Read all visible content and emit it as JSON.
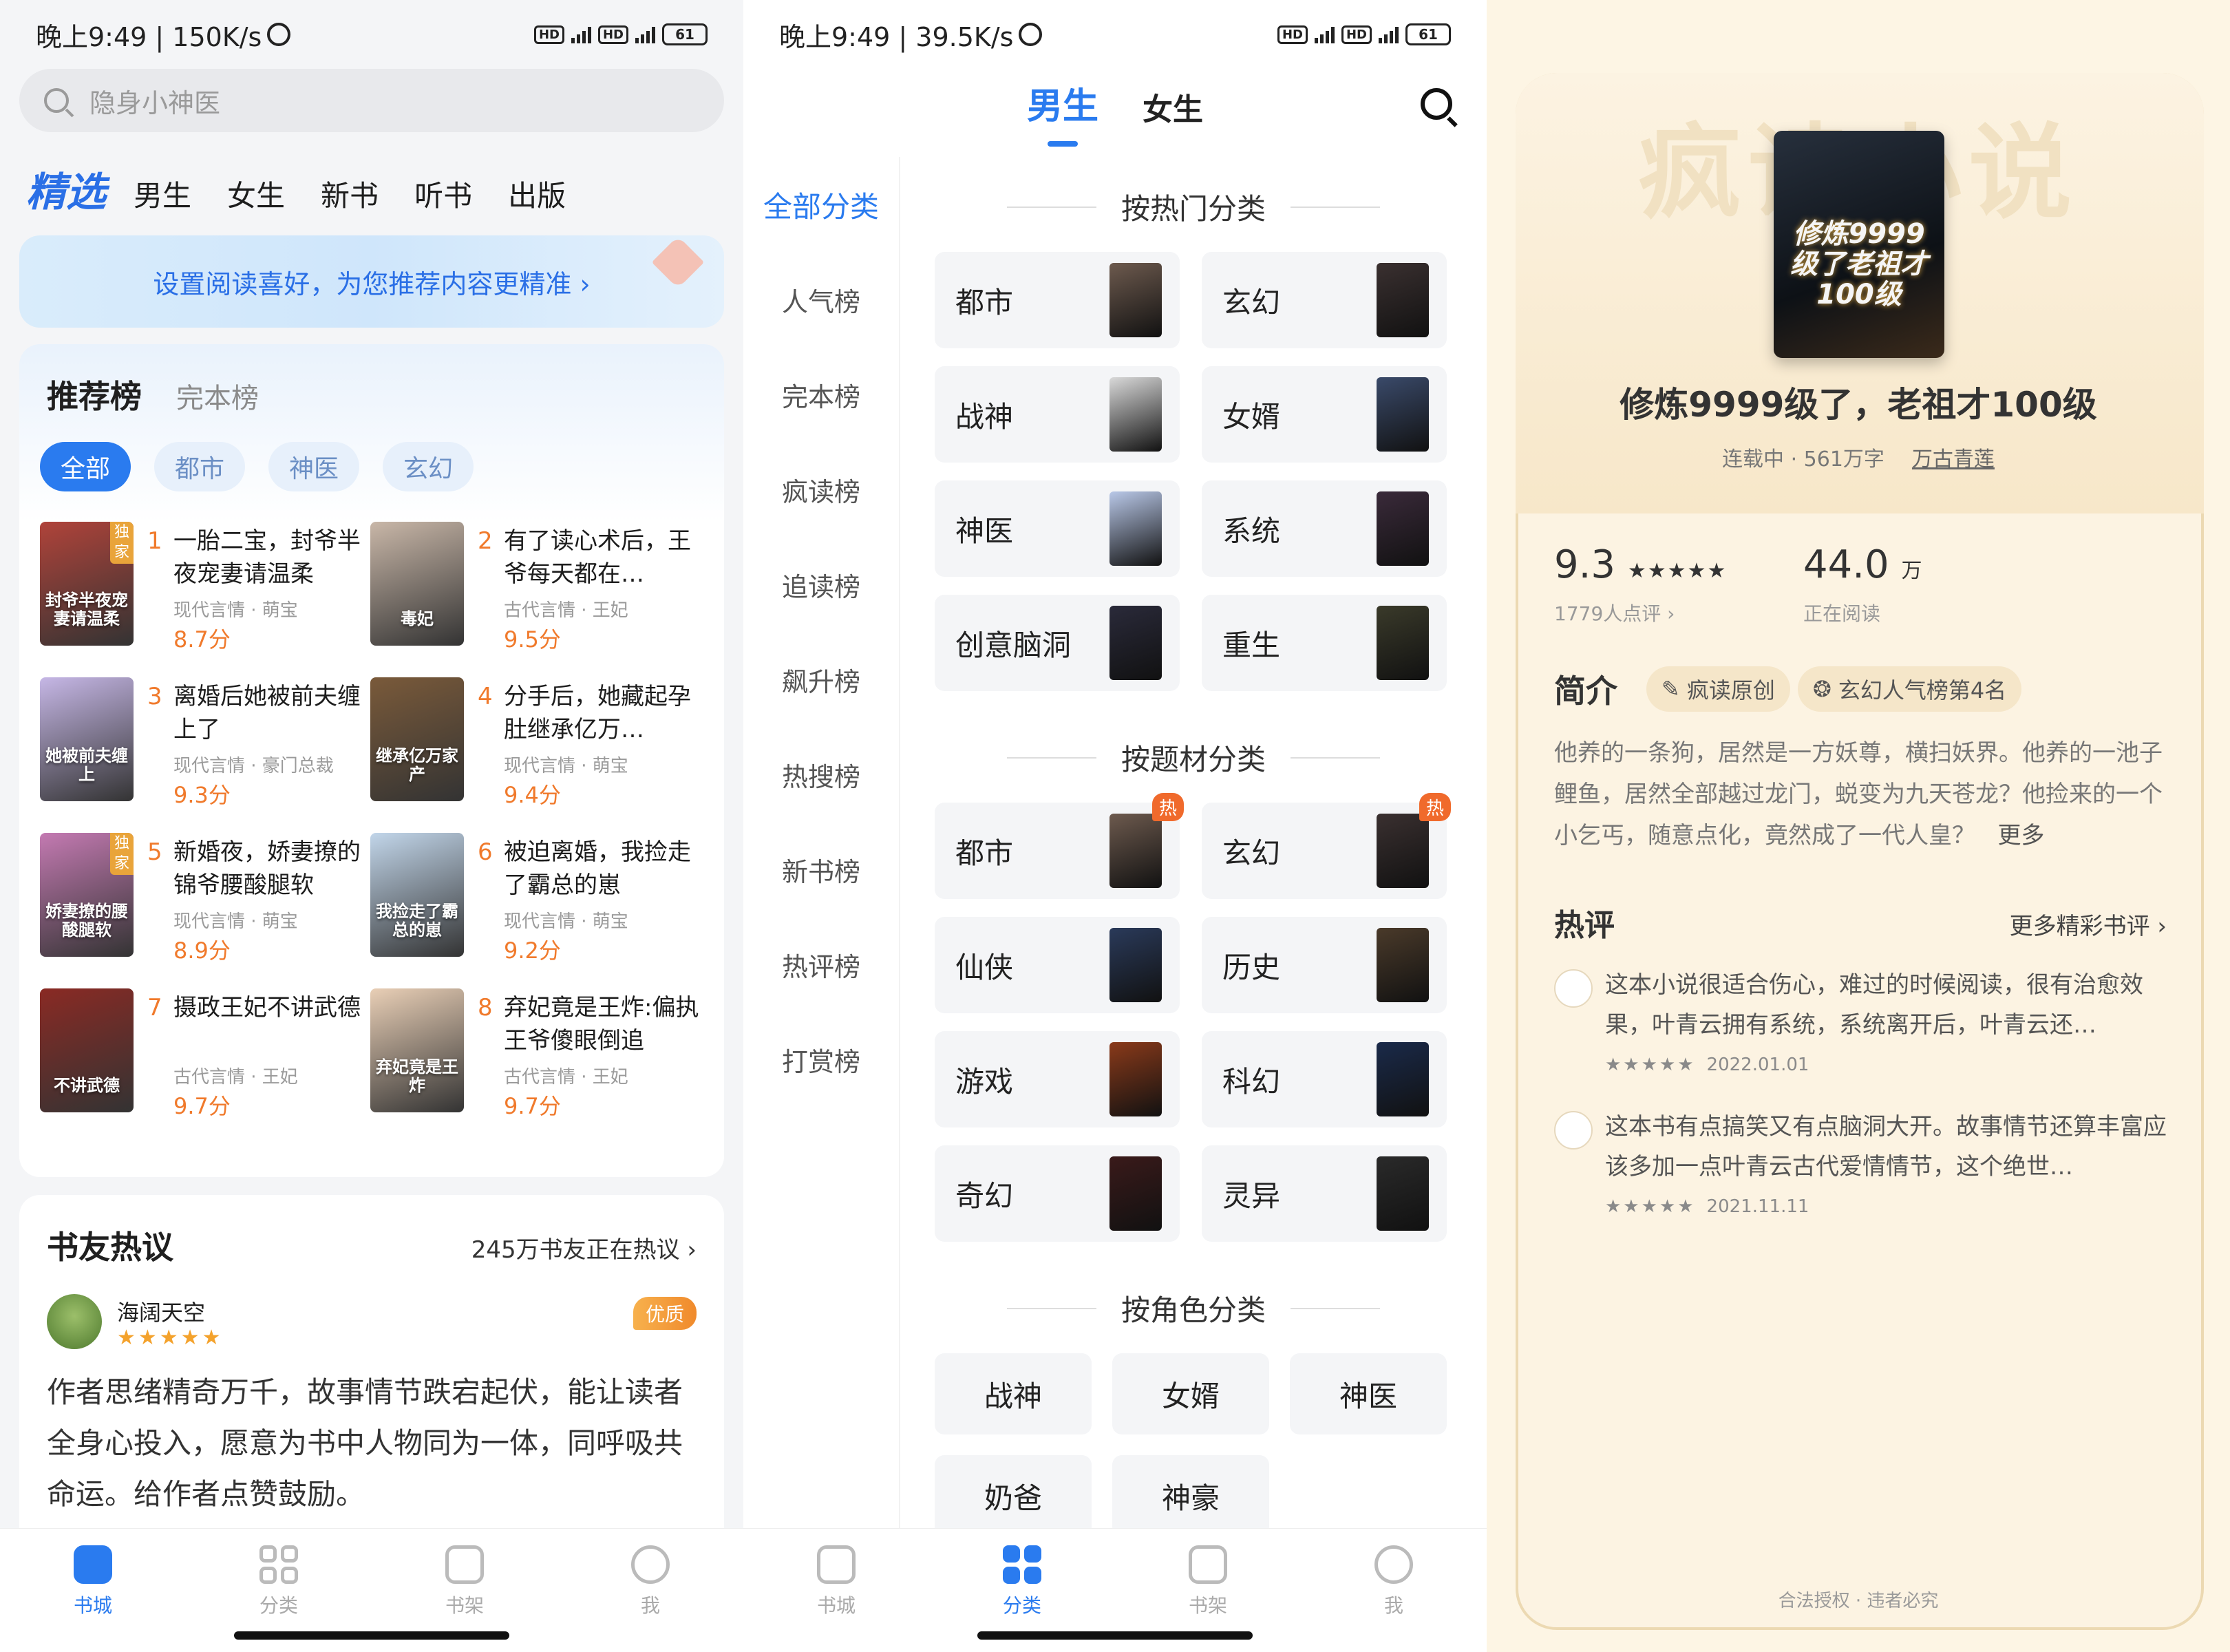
{
  "panel1": {
    "status": {
      "time": "晚上9:49 | 150K/s",
      "battery": "61"
    },
    "search": {
      "placeholder": "隐身小神医"
    },
    "nav": [
      "精选",
      "男生",
      "女生",
      "新书",
      "听书",
      "出版"
    ],
    "banner": "设置阅读喜好，为您推荐内容更精准 ›",
    "rank": {
      "title": "推荐榜",
      "subtitle": "完本榜",
      "chips": [
        "全部",
        "都市",
        "神医",
        "玄幻"
      ],
      "books": [
        {
          "num": "1",
          "title": "一胎二宝，封爷半夜宠妻请温柔",
          "meta": "现代言情 · 萌宝",
          "score": "8.7分",
          "cover_text": "封爷半夜宠妻请温柔",
          "tag": "独家",
          "cover_color": "#b0433a"
        },
        {
          "num": "2",
          "title": "有了读心术后，王爷每天都在…",
          "meta": "古代言情 · 王妃",
          "score": "9.5分",
          "cover_text": "毒妃",
          "tag": "",
          "cover_color": "#c9b7a8"
        },
        {
          "num": "3",
          "title": "离婚后她被前夫缠上了",
          "meta": "现代言情 · 豪门总裁",
          "score": "9.3分",
          "cover_text": "她被前夫缠上",
          "tag": "",
          "cover_color": "#c6b7e6"
        },
        {
          "num": "4",
          "title": "分手后，她藏起孕肚继承亿万…",
          "meta": "现代言情 · 萌宝",
          "score": "9.4分",
          "cover_text": "继承亿万家产",
          "tag": "",
          "cover_color": "#7a5a3a"
        },
        {
          "num": "5",
          "title": "新婚夜，娇妻撩的锦爷腰酸腿软",
          "meta": "现代言情 · 萌宝",
          "score": "8.9分",
          "cover_text": "娇妻撩的腰酸腿软",
          "tag": "独家",
          "cover_color": "#c47ab2"
        },
        {
          "num": "6",
          "title": "被迫离婚，我捡走了霸总的崽",
          "meta": "现代言情 · 萌宝",
          "score": "9.2分",
          "cover_text": "我捡走了霸总的崽",
          "tag": "",
          "cover_color": "#c2d6ea"
        },
        {
          "num": "7",
          "title": "摄政王妃不讲武德",
          "meta": "古代言情 · 王妃",
          "score": "9.7分",
          "cover_text": "不讲武德",
          "tag": "",
          "cover_color": "#8a2a24"
        },
        {
          "num": "8",
          "title": "弃妃竟是王炸:偏执王爷傻眼倒追",
          "meta": "古代言情 · 王妃",
          "score": "9.7分",
          "cover_text": "弃妃竟是王炸",
          "tag": "",
          "cover_color": "#e9cfb6"
        }
      ]
    },
    "discuss": {
      "title": "书友热议",
      "count": "245万书友正在热议 ›",
      "user": "海阔天空",
      "stars": "★★★★★",
      "badge": "优质",
      "text": "作者思绪精奇万千，故事情节跌宕起伏，能让读者全身心投入，愿意为书中人物同为一体，同呼吸共命运。给作者点赞鼓励。"
    },
    "tabs": [
      "书城",
      "分类",
      "书架",
      "我"
    ]
  },
  "panel2": {
    "status": {
      "time": "晚上9:49 | 39.5K/s",
      "battery": "61"
    },
    "gender_tabs": [
      "男生",
      "女生"
    ],
    "left_nav": [
      "全部分类",
      "人气榜",
      "完本榜",
      "疯读榜",
      "追读榜",
      "飙升榜",
      "热搜榜",
      "新书榜",
      "热评榜",
      "打赏榜"
    ],
    "hot_section": {
      "title": "按热门分类",
      "items": [
        {
          "label": "都市",
          "color": "#6d5a4e"
        },
        {
          "label": "玄幻",
          "color": "#3a3030"
        },
        {
          "label": "战神",
          "color": "#d9d9d9"
        },
        {
          "label": "女婿",
          "color": "#3a4a6a"
        },
        {
          "label": "神医",
          "color": "#b9c8e8"
        },
        {
          "label": "系统",
          "color": "#3a2a3a"
        },
        {
          "label": "创意脑洞",
          "color": "#2a2a3a"
        },
        {
          "label": "重生",
          "color": "#3a3a2a"
        }
      ]
    },
    "theme_section": {
      "title": "按题材分类",
      "hot_label": "热",
      "items": [
        {
          "label": "都市",
          "color": "#6d5a4e",
          "hot": true
        },
        {
          "label": "玄幻",
          "color": "#3a3030",
          "hot": true
        },
        {
          "label": "仙侠",
          "color": "#2a3a5a",
          "hot": false
        },
        {
          "label": "历史",
          "color": "#4a3a2a",
          "hot": false
        },
        {
          "label": "游戏",
          "color": "#8a3a1a",
          "hot": false
        },
        {
          "label": "科幻",
          "color": "#1a2a4a",
          "hot": false
        },
        {
          "label": "奇幻",
          "color": "#3a1a1a",
          "hot": false
        },
        {
          "label": "灵异",
          "color": "#2a2a2a",
          "hot": false
        }
      ]
    },
    "role_section": {
      "title": "按角色分类",
      "items": [
        {
          "label": "战神",
          "hot": true
        },
        {
          "label": "女婿",
          "hot": true
        },
        {
          "label": "神医",
          "hot": true
        },
        {
          "label": "奶爸",
          "hot": false
        },
        {
          "label": "神豪",
          "hot": false
        }
      ]
    },
    "tabs": [
      "书城",
      "分类",
      "书架",
      "我"
    ]
  },
  "panel3": {
    "watermark": "疯读小说",
    "cover_text": "修炼9999级了老祖才100级",
    "title": "修炼9999级了，老祖才100级",
    "status": "连载中 · 561万字",
    "author": "万古青莲",
    "score": "9.3",
    "score_stars": "★★★★★",
    "score_label": "1779人点评 ›",
    "readers": "44.0",
    "readers_unit": "万",
    "readers_label": "正在阅读",
    "intro_title": "简介",
    "pills": [
      "疯读原创",
      "玄幻人气榜第4名"
    ],
    "intro": "他养的一条狗，居然是一方妖尊，横扫妖界。他养的一池子鲤鱼，居然全部越过龙门，蜕变为九天苍龙？他捡来的一个小乞丐，随意点化，竟然成了一代人皇？",
    "intro_more": "更多",
    "hot_title": "热评",
    "hot_more": "更多精彩书评 ›",
    "comments": [
      {
        "text": "这本小说很适合伤心，难过的时候阅读，很有治愈效果，叶青云拥有系统，系统离开后，叶青云还…",
        "stars": "★★★★★",
        "date": "2022.01.01"
      },
      {
        "text": "这本书有点搞笑又有点脑洞大开。故事情节还算丰富应该多加一点叶青云古代爱情情节，这个绝世…",
        "stars": "★★★★★",
        "date": "2021.11.11"
      }
    ],
    "footer": "合法授权 · 违者必究"
  }
}
